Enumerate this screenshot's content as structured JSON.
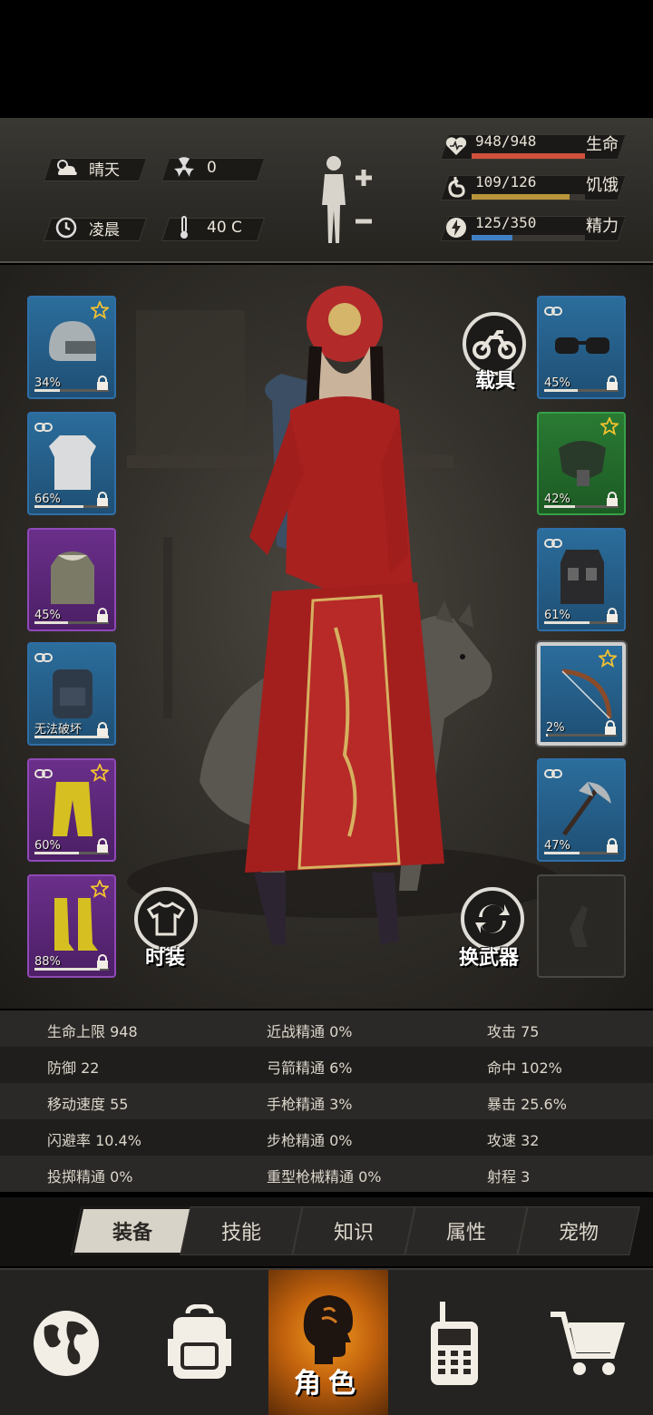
{
  "environment": {
    "weather": {
      "icon": "cloud-sun-icon",
      "label": "晴天"
    },
    "radiation": {
      "icon": "radiation-icon",
      "value": "0"
    },
    "time": {
      "icon": "clock-icon",
      "label": "凌晨"
    },
    "temperature": {
      "icon": "thermometer-icon",
      "value": "40 C"
    }
  },
  "vitals": [
    {
      "name": "生命",
      "value": "948/948",
      "fraction": 1.0,
      "color": "#d0503c",
      "icon": "heart-icon"
    },
    {
      "name": "饥饿",
      "value": "109/126",
      "fraction": 0.865,
      "color": "#b9953a",
      "icon": "stomach-icon"
    },
    {
      "name": "精力",
      "value": "125/350",
      "fraction": 0.357,
      "color": "#3f7fc4",
      "icon": "energy-icon"
    }
  ],
  "left_slots": [
    {
      "item": "helmet-icon",
      "percent": "34%",
      "fraction": 0.34,
      "rarity": "blue",
      "star": true,
      "link": false
    },
    {
      "item": "shirt-icon",
      "percent": "66%",
      "fraction": 0.66,
      "rarity": "blue",
      "star": false,
      "link": true
    },
    {
      "item": "fur-coat-icon",
      "percent": "45%",
      "fraction": 0.45,
      "rarity": "purple",
      "star": false,
      "link": false
    },
    {
      "item": "backpack-icon",
      "percent": "无法破坏",
      "fraction": 1.0,
      "rarity": "blue",
      "star": false,
      "link": true
    },
    {
      "item": "pants-icon",
      "percent": "60%",
      "fraction": 0.6,
      "rarity": "purple",
      "star": true,
      "link": true
    },
    {
      "item": "boots-icon",
      "percent": "88%",
      "fraction": 0.88,
      "rarity": "purple",
      "star": true,
      "link": false
    }
  ],
  "right_slots": [
    {
      "item": "goggles-icon",
      "percent": "45%",
      "fraction": 0.45,
      "rarity": "blue",
      "star": false,
      "link": true
    },
    {
      "item": "gas-mask-icon",
      "percent": "42%",
      "fraction": 0.42,
      "rarity": "green",
      "star": true,
      "link": false
    },
    {
      "item": "vest-icon",
      "percent": "61%",
      "fraction": 0.61,
      "rarity": "blue",
      "star": false,
      "link": true
    },
    {
      "item": "bow-icon",
      "percent": "2%",
      "fraction": 0.02,
      "rarity": "blue",
      "star": true,
      "link": false,
      "selected": true
    },
    {
      "item": "axe-icon",
      "percent": "47%",
      "fraction": 0.47,
      "rarity": "blue",
      "star": false,
      "link": true
    },
    {
      "item": "bottle-icon",
      "percent": "",
      "fraction": 0,
      "rarity": "empty",
      "star": false,
      "link": false
    }
  ],
  "buttons": {
    "vehicle": "载具",
    "fashion": "时装",
    "switch_weapon": "换武器"
  },
  "stats": [
    [
      "生命上限 948",
      "近战精通 0%",
      "攻击 75"
    ],
    [
      "防御 22",
      "弓箭精通 6%",
      "命中 102%"
    ],
    [
      "移动速度 55",
      "手枪精通 3%",
      "暴击 25.6%"
    ],
    [
      "闪避率 10.4%",
      "步枪精通 0%",
      "攻速 32"
    ],
    [
      "投掷精通 0%",
      "重型枪械精通 0%",
      "射程 3"
    ]
  ],
  "tabs": [
    "装备",
    "技能",
    "知识",
    "属性",
    "宠物"
  ],
  "active_tab": 0,
  "nav": {
    "items": [
      "globe-icon",
      "backpack-icon",
      "character-icon",
      "walkie-talkie-icon",
      "cart-icon"
    ],
    "active_label": "角色"
  }
}
